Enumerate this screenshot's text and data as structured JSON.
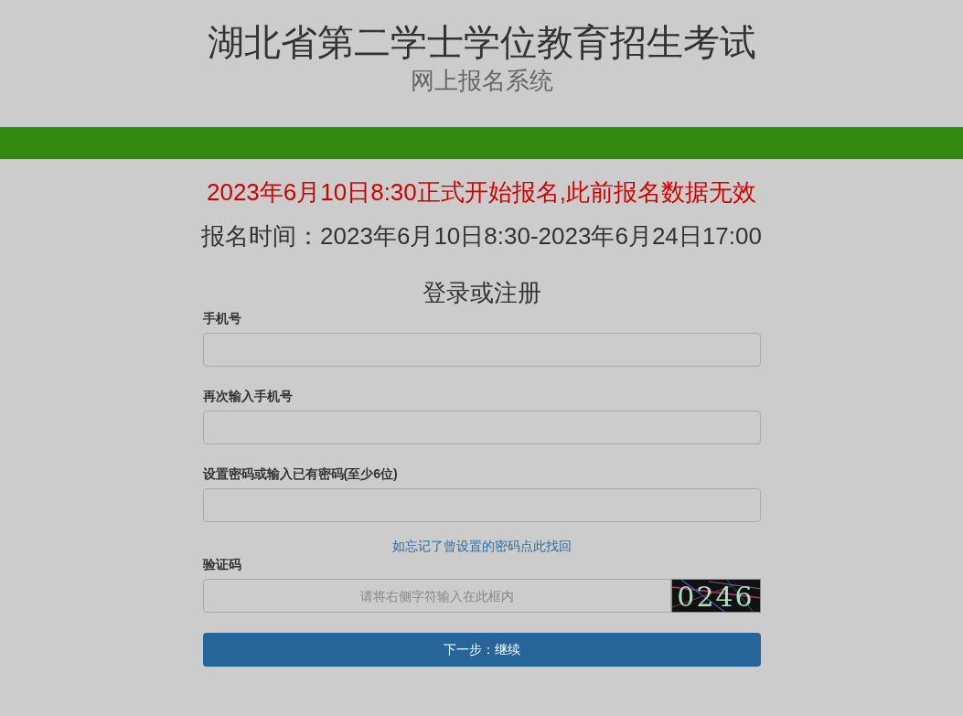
{
  "header": {
    "title": "湖北省第二学士学位教育招生考试",
    "subtitle": "网上报名系统"
  },
  "notice": "2023年6月10日8:30正式开始报名,此前报名数据无效",
  "period": "报名时间：2023年6月10日8:30-2023年6月24日17:00",
  "form": {
    "title": "登录或注册",
    "fields": [
      {
        "kind": "text",
        "label": "手机号"
      },
      {
        "kind": "text",
        "label": "再次输入手机号"
      },
      {
        "kind": "text",
        "label": "设置密码或输入已有密码(至少6位)"
      },
      {
        "kind": "link",
        "text": "如忘记了曾设置的密码点此找回"
      },
      {
        "kind": "captcha",
        "label": "验证码",
        "placeholder": "请将右侧字符输入在此框内",
        "code": "0246"
      }
    ],
    "submit": "下一步：继续"
  }
}
